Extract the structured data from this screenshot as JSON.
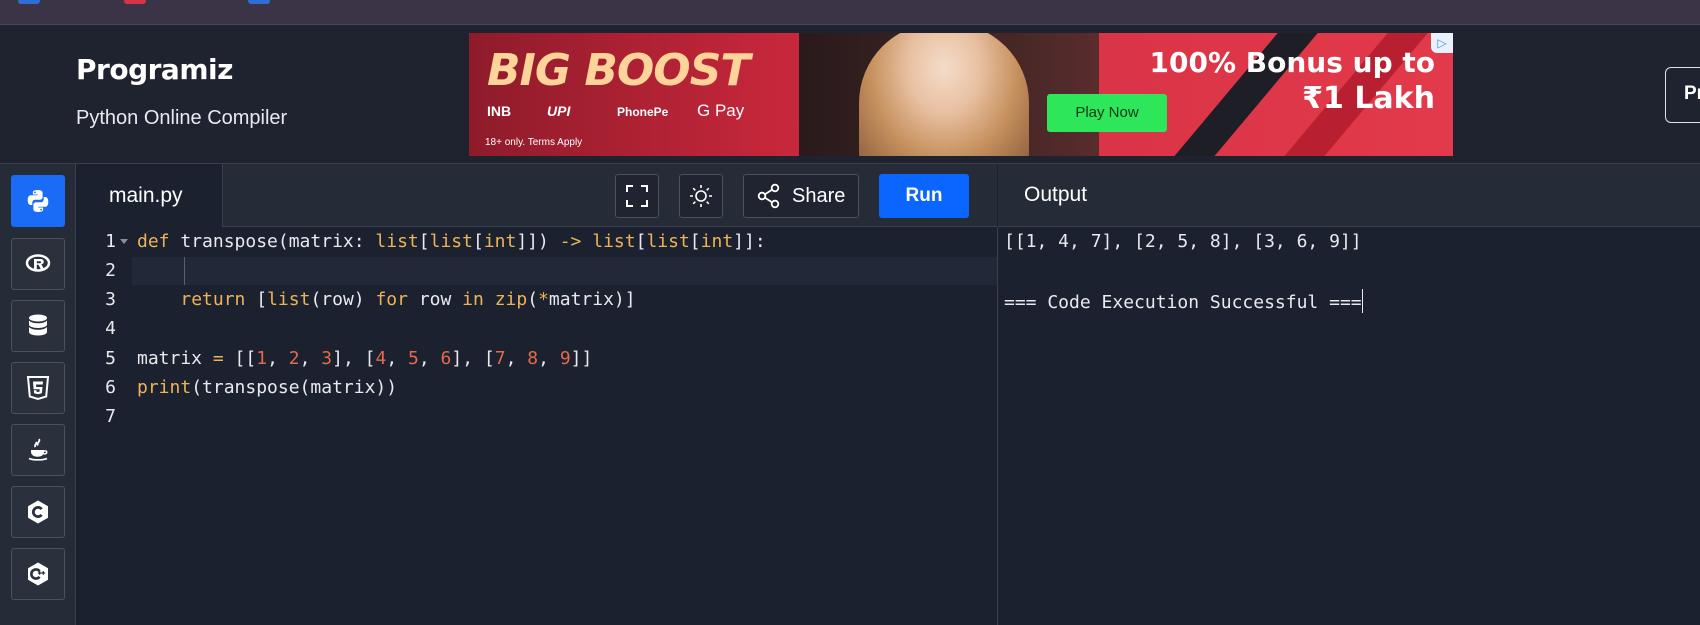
{
  "brand": {
    "logo": "Programiz",
    "subtitle": "Python Online Compiler",
    "header_button": "Pr"
  },
  "ad": {
    "headline": "BIG BOOST",
    "payments": [
      "INB",
      "UPI",
      "PhonePe",
      "G Pay"
    ],
    "terms": "18+ only. Terms Apply",
    "bonus_line1": "100% Bonus up to",
    "bonus_line2": "₹1 Lakh",
    "cta": "Play Now",
    "badge": "▷"
  },
  "sidebar": {
    "languages": [
      {
        "name": "python-icon",
        "active": true
      },
      {
        "name": "r-icon",
        "active": false
      },
      {
        "name": "sql-icon",
        "active": false
      },
      {
        "name": "html5-icon",
        "active": false
      },
      {
        "name": "java-icon",
        "active": false
      },
      {
        "name": "c-icon",
        "active": false
      },
      {
        "name": "cpp-icon",
        "active": false
      }
    ]
  },
  "editor": {
    "file_tab": "main.py",
    "share_label": "Share",
    "run_label": "Run",
    "line_numbers": [
      "1",
      "2",
      "3",
      "4",
      "5",
      "6",
      "7"
    ]
  },
  "code": {
    "l1": {
      "kw_def": "def",
      "fname": " transpose(matrix: ",
      "t1": "list",
      "b1": "[",
      "t2": "list",
      "b2": "[",
      "t3": "int",
      "b3": "]]) ",
      "arrow": "->",
      "sp": " ",
      "t4": "list",
      "b4": "[",
      "t5": "list",
      "b5": "[",
      "t6": "int",
      "b6": "]]:"
    },
    "l3": {
      "indent": "    ",
      "kw_return": "return",
      "p1": " [",
      "f_list": "list",
      "p2": "(row) ",
      "kw_for": "for",
      "p3": " row ",
      "kw_in": "in",
      "p4": " ",
      "f_zip": "zip",
      "p5": "(",
      "star": "*",
      "p6": "matrix)]"
    },
    "l5": {
      "var": "matrix ",
      "eq": "=",
      "p0": " [[",
      "n1": "1",
      "c1": ", ",
      "n2": "2",
      "c2": ", ",
      "n3": "3",
      "c3": "], [",
      "n4": "4",
      "c4": ", ",
      "n5": "5",
      "c5": ", ",
      "n6": "6",
      "c6": "], [",
      "n7": "7",
      "c7": ", ",
      "n8": "8",
      "c8": ", ",
      "n9": "9",
      "c9": "]]"
    },
    "l6": {
      "f_print": "print",
      "rest": "(transpose(matrix))"
    }
  },
  "output": {
    "title": "Output",
    "lines": [
      "[[1, 4, 7], [2, 5, 8], [3, 6, 9]]",
      "",
      "=== Code Execution Successful ==="
    ]
  },
  "colors": {
    "run": "#0a66ff",
    "active_lang": "#1a6bf5",
    "keyword": "#ecb456",
    "number": "#e26a4a",
    "cta": "#2ee65a"
  }
}
